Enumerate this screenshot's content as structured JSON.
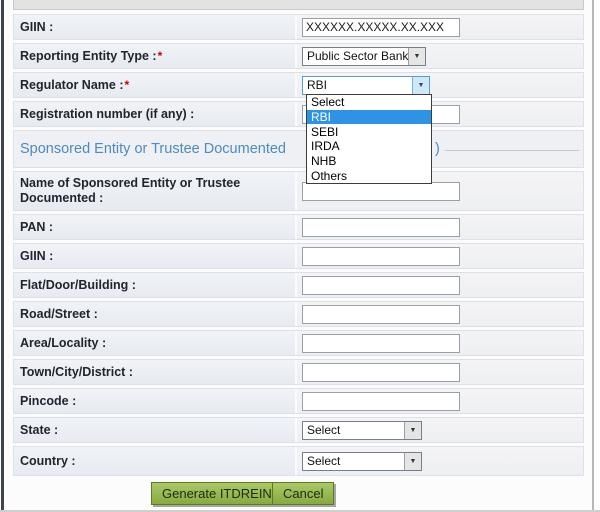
{
  "colors": {
    "button_green": "#8db549",
    "dropdown_highlight_blue": "#2f93e5",
    "heading_blue": "#4c8bbf",
    "required_red": "#cc0000"
  },
  "misc": {
    "required_marker": "*"
  },
  "section_heading": {
    "visible_left": "Sponsored Entity or Trustee Documented",
    "visible_right": ")"
  },
  "fields": {
    "giin_top": {
      "label": "GIIN :",
      "value": "XXXXXX.XXXXX.XX.XXX"
    },
    "reporting_entity_type": {
      "label": "Reporting Entity Type :",
      "value": "Public Sector Bank"
    },
    "regulator_name": {
      "label": "Regulator Name :",
      "value": "RBI"
    },
    "registration_number": {
      "label": "Registration number (if any) :",
      "value": ""
    },
    "sponsored_name": {
      "label": "Name of Sponsored Entity or Trustee Documented :",
      "value": ""
    },
    "pan": {
      "label": "PAN :",
      "value": ""
    },
    "giin_sponsored": {
      "label": "GIIN :",
      "value": ""
    },
    "flat": {
      "label": "Flat/Door/Building :",
      "value": ""
    },
    "road": {
      "label": "Road/Street :",
      "value": ""
    },
    "area": {
      "label": "Area/Locality :",
      "value": ""
    },
    "town": {
      "label": "Town/City/District :",
      "value": ""
    },
    "pincode": {
      "label": "Pincode :",
      "value": ""
    },
    "state": {
      "label": "State :",
      "value": "Select"
    },
    "country": {
      "label": "Country :",
      "value": "Select"
    }
  },
  "regulator_dropdown": {
    "options": [
      "Select",
      "RBI",
      "SEBI",
      "IRDA",
      "NHB",
      "Others"
    ],
    "selected": "RBI"
  },
  "buttons": {
    "generate": "Generate ITDREIN",
    "cancel": "Cancel"
  }
}
